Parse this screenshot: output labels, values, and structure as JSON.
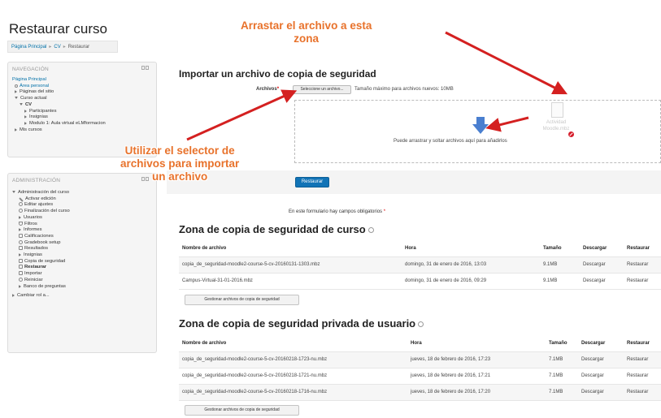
{
  "page": {
    "title": "Restaurar curso",
    "breadcrumb": [
      "Página Principal",
      "CV",
      "Restaurar"
    ]
  },
  "navigation": {
    "title": "NAVEGACIÓN",
    "items": [
      "Página Principal",
      "Área personal",
      "Páginas del sitio",
      "Curso actual",
      "CV",
      "Participantes",
      "Insignias",
      "Modulo 1: Aula virtual eLMformacion",
      "Mis cursos"
    ]
  },
  "administration": {
    "title": "ADMINISTRACIÓN",
    "items": [
      "Administración del curso",
      "Activar edición",
      "Editar ajustes",
      "Finalización del curso",
      "Usuarios",
      "Filtros",
      "Informes",
      "Calificaciones",
      "Gradebook setup",
      "Resultados",
      "Insignias",
      "Copia de seguridad",
      "Restaurar",
      "Importar",
      "Reiniciar",
      "Banco de preguntas",
      "Cambiar rol a..."
    ]
  },
  "import": {
    "title": "Importar un archivo de copia de seguridad",
    "file_label": "Archivos",
    "required_mark": "*",
    "select_button": "Seleccione un archivo...",
    "max_size": "Tamaño máximo para archivos nuevos: 10MB",
    "drop_text": "Puede arrastrar y soltar archivos aquí para añadirlos",
    "drag_ghost_label": "Actividad Moodle.mbz"
  },
  "restore_button": "Restaurar",
  "required_note": "En este formulario hay campos obligatorios",
  "required_note_mark": "*",
  "course_zone": {
    "title": "Zona de copia de seguridad de curso",
    "columns": [
      "Nombre de archivo",
      "Hora",
      "Tamaño",
      "Descargar",
      "Restaurar"
    ],
    "rows": [
      [
        "copia_de_seguridad-moodle2-course-5-cv-20160131-1303.mbz",
        "domingo, 31 de enero de 2016, 13:03",
        "9.1MB",
        "Descargar",
        "Restaurar"
      ],
      [
        "Campus-Virtual-31-01-2016.mbz",
        "domingo, 31 de enero de 2016, 09:29",
        "9.1MB",
        "Descargar",
        "Restaurar"
      ]
    ],
    "manage_button": "Gestionar archivos de copia de seguridad"
  },
  "user_zone": {
    "title": "Zona de copia de seguridad privada de usuario",
    "columns": [
      "Nombre de archivo",
      "Hora",
      "Tamaño",
      "Descargar",
      "Restaurar"
    ],
    "rows": [
      [
        "copia_de_seguridad-moodle2-course-5-cv-20160218-1723-nu.mbz",
        "jueves, 18 de febrero de 2016, 17:23",
        "7.1MB",
        "Descargar",
        "Restaurar"
      ],
      [
        "copia_de_seguridad-moodle2-course-5-cv-20160218-1721-nu.mbz",
        "jueves, 18 de febrero de 2016, 17:21",
        "7.1MB",
        "Descargar",
        "Restaurar"
      ],
      [
        "copia_de_seguridad-moodle2-course-5-cv-20160218-1716-nu.mbz",
        "jueves, 18 de febrero de 2016, 17:20",
        "7.1MB",
        "Descargar",
        "Restaurar"
      ]
    ],
    "manage_button": "Gestionar archivos de copia de seguridad"
  },
  "annotations": {
    "drag": [
      "Arrastar el archivo a esta",
      "zona"
    ],
    "selector": [
      "Utilizar el selector de",
      "archivos para importar",
      "un archivo"
    ]
  },
  "colors": {
    "annotation": "#e8722b",
    "arrow": "#d42020",
    "primary_button": "#1173b6",
    "link": "#0070a8",
    "drop_arrow": "#4a7fd0"
  }
}
